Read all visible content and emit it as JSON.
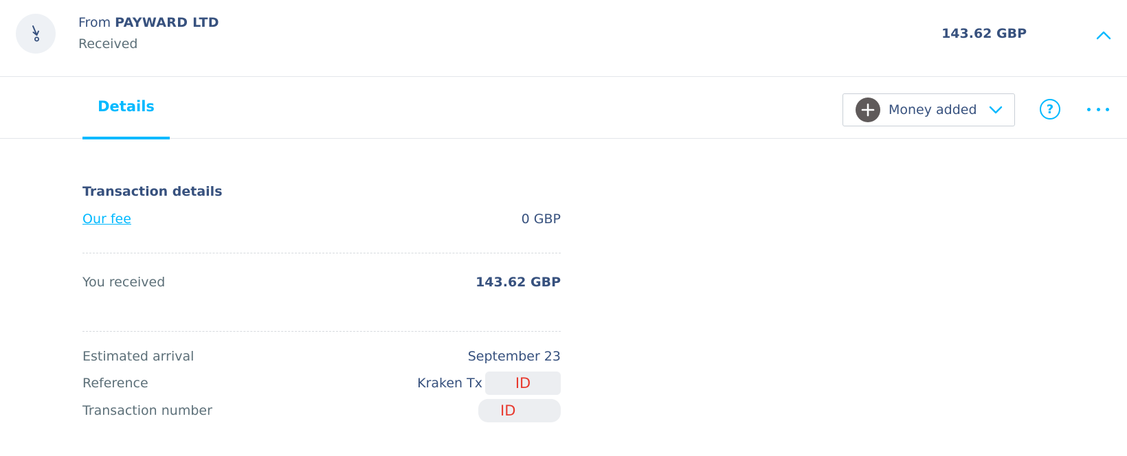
{
  "header": {
    "from_prefix": "From ",
    "from_name": "PAYWARD LTD",
    "status": "Received",
    "amount": "143.62 GBP"
  },
  "tabs": {
    "details_label": "Details"
  },
  "category": {
    "label": "Money added"
  },
  "help": {
    "label": "?"
  },
  "transaction": {
    "section_title": "Transaction details",
    "fee_label": "Our fee",
    "fee_value": "0 GBP",
    "received_label": "You received",
    "received_value": "143.62 GBP",
    "arrival_label": "Estimated arrival",
    "arrival_value": "September 23",
    "reference_label": "Reference",
    "reference_value": "Kraken Tx",
    "reference_redacted": "ID",
    "txn_number_label": "Transaction number",
    "txn_number_redacted": "ID"
  },
  "colors": {
    "accent": "#00b9ff",
    "text_primary": "#37517e",
    "text_secondary": "#5d7079",
    "redaction_text": "#e8392e"
  },
  "icons": {
    "avatar": "incoming-transfer-icon",
    "collapse": "chevron-up-icon",
    "category": "plus-circle-icon",
    "category_dropdown": "chevron-down-icon",
    "help": "question-circle-icon",
    "more": "more-options-icon"
  }
}
